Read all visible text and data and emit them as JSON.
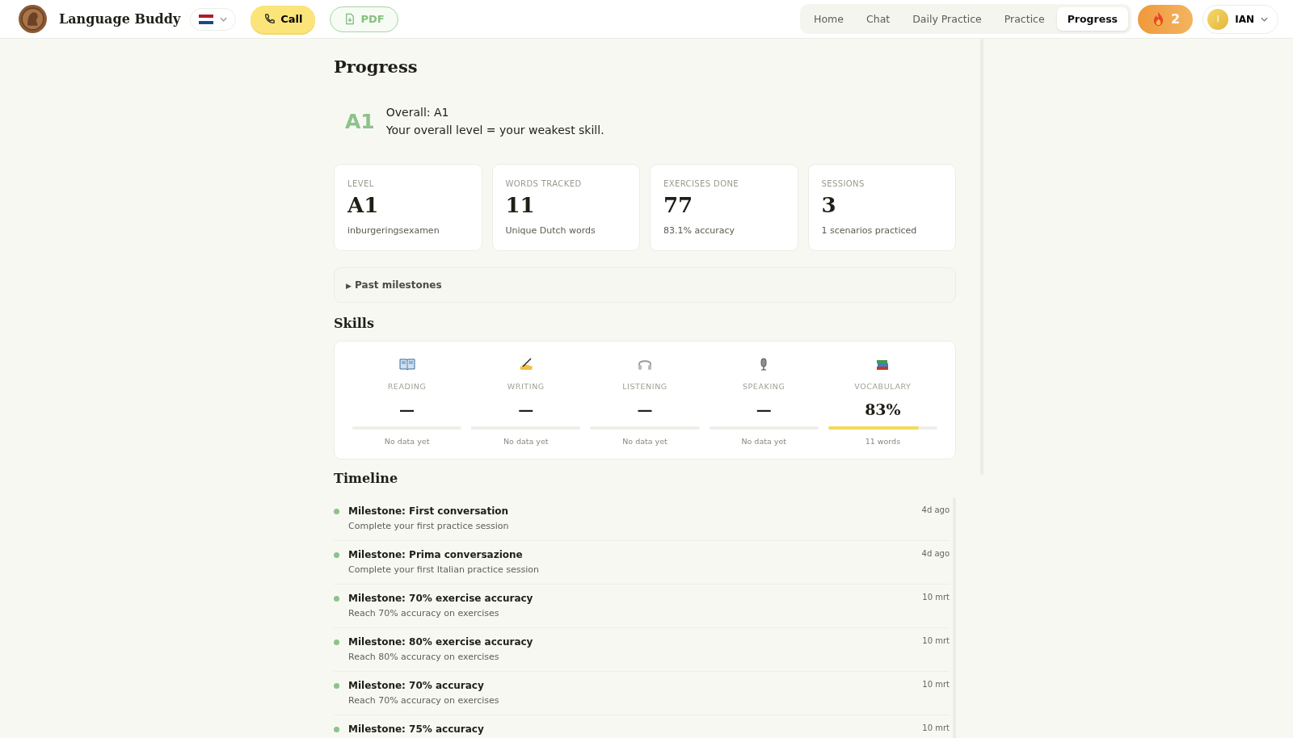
{
  "header": {
    "app_name": "Language Buddy",
    "call_button": "Call",
    "pdf_button": "PDF",
    "nav": [
      {
        "label": "Home",
        "selected": false
      },
      {
        "label": "Chat",
        "selected": false
      },
      {
        "label": "Daily Practice",
        "selected": false
      },
      {
        "label": "Practice",
        "selected": false
      },
      {
        "label": "Progress",
        "selected": true
      }
    ],
    "streak": "2",
    "user": {
      "initial": "I",
      "name": "IAN"
    }
  },
  "page_title": "Progress",
  "overall": {
    "badge": "A1",
    "title": "Overall: A1",
    "subtitle": "Your overall level = your weakest skill."
  },
  "stats": [
    {
      "label": "LEVEL",
      "value": "A1",
      "note": "inburgeringsexamen"
    },
    {
      "label": "WORDS TRACKED",
      "value": "11",
      "note": "Unique Dutch words"
    },
    {
      "label": "EXERCISES DONE",
      "value": "77",
      "note": "83.1% accuracy"
    },
    {
      "label": "SESSIONS",
      "value": "3",
      "note": "1 scenarios practiced"
    }
  ],
  "past_milestones": {
    "marker": "▶",
    "label": "Past milestones"
  },
  "skills_title": "Skills",
  "skills": [
    {
      "kind": "book",
      "label": "READING",
      "value": "—",
      "level": 0,
      "note": "No data yet"
    },
    {
      "kind": "pen",
      "label": "WRITING",
      "value": "—",
      "level": 0,
      "note": "No data yet"
    },
    {
      "kind": "headphones",
      "label": "LISTENING",
      "value": "—",
      "level": 0,
      "note": "No data yet"
    },
    {
      "kind": "mic",
      "label": "SPEAKING",
      "value": "—",
      "level": 0,
      "note": "No data yet"
    },
    {
      "kind": "books",
      "label": "VOCABULARY",
      "value": "83%",
      "level": 0.83,
      "note": "11 words"
    }
  ],
  "timeline_title": "Timeline",
  "timeline": [
    {
      "title": "Milestone: First conversation",
      "desc": "Complete your first practice session",
      "time": "4d ago"
    },
    {
      "title": "Milestone: Prima conversazione",
      "desc": "Complete your first Italian practice session",
      "time": "4d ago"
    },
    {
      "title": "Milestone: 70% exercise accuracy",
      "desc": "Reach 70% accuracy on exercises",
      "time": "10 mrt"
    },
    {
      "title": "Milestone: 80% exercise accuracy",
      "desc": "Reach 80% accuracy on exercises",
      "time": "10 mrt"
    },
    {
      "title": "Milestone: 70% accuracy",
      "desc": "Reach 70% accuracy on exercises",
      "time": "10 mrt"
    },
    {
      "title": "Milestone: 75% accuracy",
      "time": "10 mrt"
    }
  ]
}
